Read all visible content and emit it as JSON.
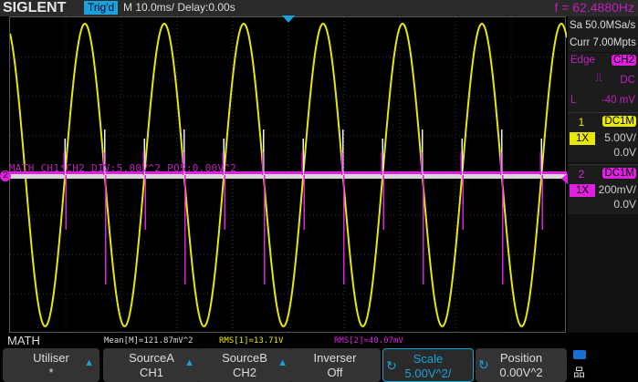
{
  "header": {
    "brand": "SIGLENT",
    "trig_status": "Trig'd",
    "timebase": "M 10.0ms/ Delay:0.00s",
    "frequency": "f = 62.4880Hz"
  },
  "acq": {
    "sample_rate": "Sa 50.0MSa/s",
    "memory": "Curr 7.00Mpts"
  },
  "trigger": {
    "type": "Edge",
    "source": "CH2",
    "coupling": "DC",
    "level_label": "L",
    "level": "-40 mV"
  },
  "channels": [
    {
      "num": "1",
      "coupling": "DC1M",
      "probe": "1X",
      "vdiv": "5.00V/",
      "offset": "0.0V",
      "color": "#e8e800"
    },
    {
      "num": "2",
      "coupling": "DC1M",
      "probe": "1X",
      "vdiv": "200mV/",
      "offset": "0.0V",
      "color": "#e020e0"
    }
  ],
  "math_trace_label": "MATH  CH1*CH2  DIV:5.00V^2  POS:0.00V^2",
  "ch2_marker": "2",
  "measurements": {
    "title": "MATH",
    "mean": "Mean[M]=121.87mV^2",
    "rms1": "RMS[1]=13.71V",
    "rms2": "RMS[2]=40.07mV"
  },
  "menu": [
    {
      "label": "Utiliser",
      "value": "*"
    },
    {
      "label": "SourceA",
      "value": "CH1"
    },
    {
      "label": "SourceB",
      "value": "CH2"
    },
    {
      "label": "Inverser",
      "value": "Off"
    },
    {
      "label": "Scale",
      "value": "5.00V^2/"
    },
    {
      "label": "Position",
      "value": "0.00V^2"
    }
  ]
}
